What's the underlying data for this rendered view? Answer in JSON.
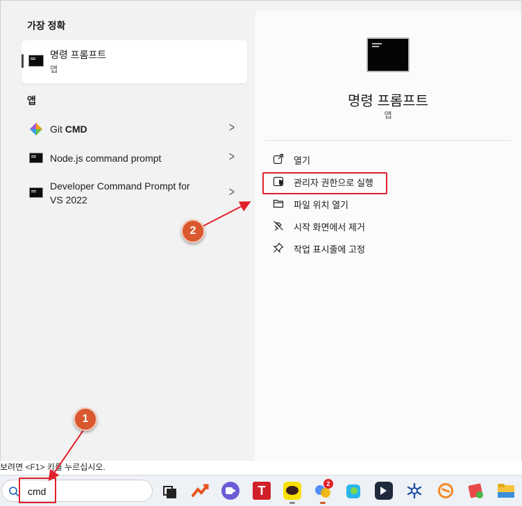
{
  "left": {
    "best_match_title": "가장 정확",
    "best_match": {
      "name": "명령 프롬프트",
      "type": "앱",
      "icon": "cmd-icon"
    },
    "apps_title": "앱",
    "apps": [
      {
        "label": "Git",
        "label_bold": "CMD",
        "icon": "git-icon"
      },
      {
        "label": "Node.js command prompt",
        "icon": "cmd-icon"
      },
      {
        "label_line1": "Developer Command Prompt for",
        "label_line2": "VS 2022",
        "icon": "cmd-icon"
      }
    ]
  },
  "right": {
    "title": "명령 프롬프트",
    "type": "앱",
    "actions": [
      {
        "label": "열기",
        "icon": "open-external-icon"
      },
      {
        "label": "관리자 권한으로 실행",
        "icon": "shield-admin-icon"
      },
      {
        "label": "파일 위치 열기",
        "icon": "folder-icon"
      },
      {
        "label": "시작 화면에서 제거",
        "icon": "unpin-icon"
      },
      {
        "label": "작업 표시줄에 고정",
        "icon": "pin-icon"
      }
    ]
  },
  "hint": "보려면 <F1> 키를 누르십시오.",
  "taskbar": {
    "search_value": "cmd",
    "notification_count": "2"
  },
  "annotations": {
    "badge1": "1",
    "badge2": "2",
    "color": "#e0202a",
    "badge_color": "#d9582f"
  }
}
